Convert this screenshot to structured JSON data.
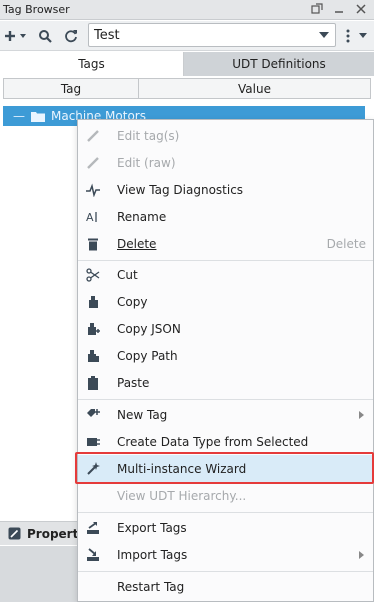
{
  "window": {
    "title": "Tag Browser"
  },
  "toolbar": {
    "provider_value": "Test"
  },
  "tabs": [
    {
      "label": "Tags"
    },
    {
      "label": "UDT Definitions"
    }
  ],
  "table": {
    "columns": [
      "Tag",
      "Value"
    ]
  },
  "tree": {
    "row_label": "Machine Motors"
  },
  "lower_panel": {
    "label": "Property"
  },
  "context_menu": {
    "items": {
      "edit_tags": "Edit tag(s)",
      "edit_raw": "Edit (raw)",
      "view_diag": "View Tag Diagnostics",
      "rename": "Rename",
      "delete": "Delete",
      "delete_shortcut": "Delete",
      "cut": "Cut",
      "copy": "Copy",
      "copy_json": "Copy JSON",
      "copy_path": "Copy Path",
      "paste": "Paste",
      "new_tag": "New Tag",
      "create_dt": "Create Data Type from Selected",
      "multi_wizard": "Multi-instance Wizard",
      "view_udt": "View UDT Hierarchy...",
      "export_tags": "Export Tags",
      "import_tags": "Import Tags",
      "restart_tag": "Restart Tag"
    },
    "highlight_color": "#e53a3a",
    "selection_color": "#3d9bd6"
  }
}
